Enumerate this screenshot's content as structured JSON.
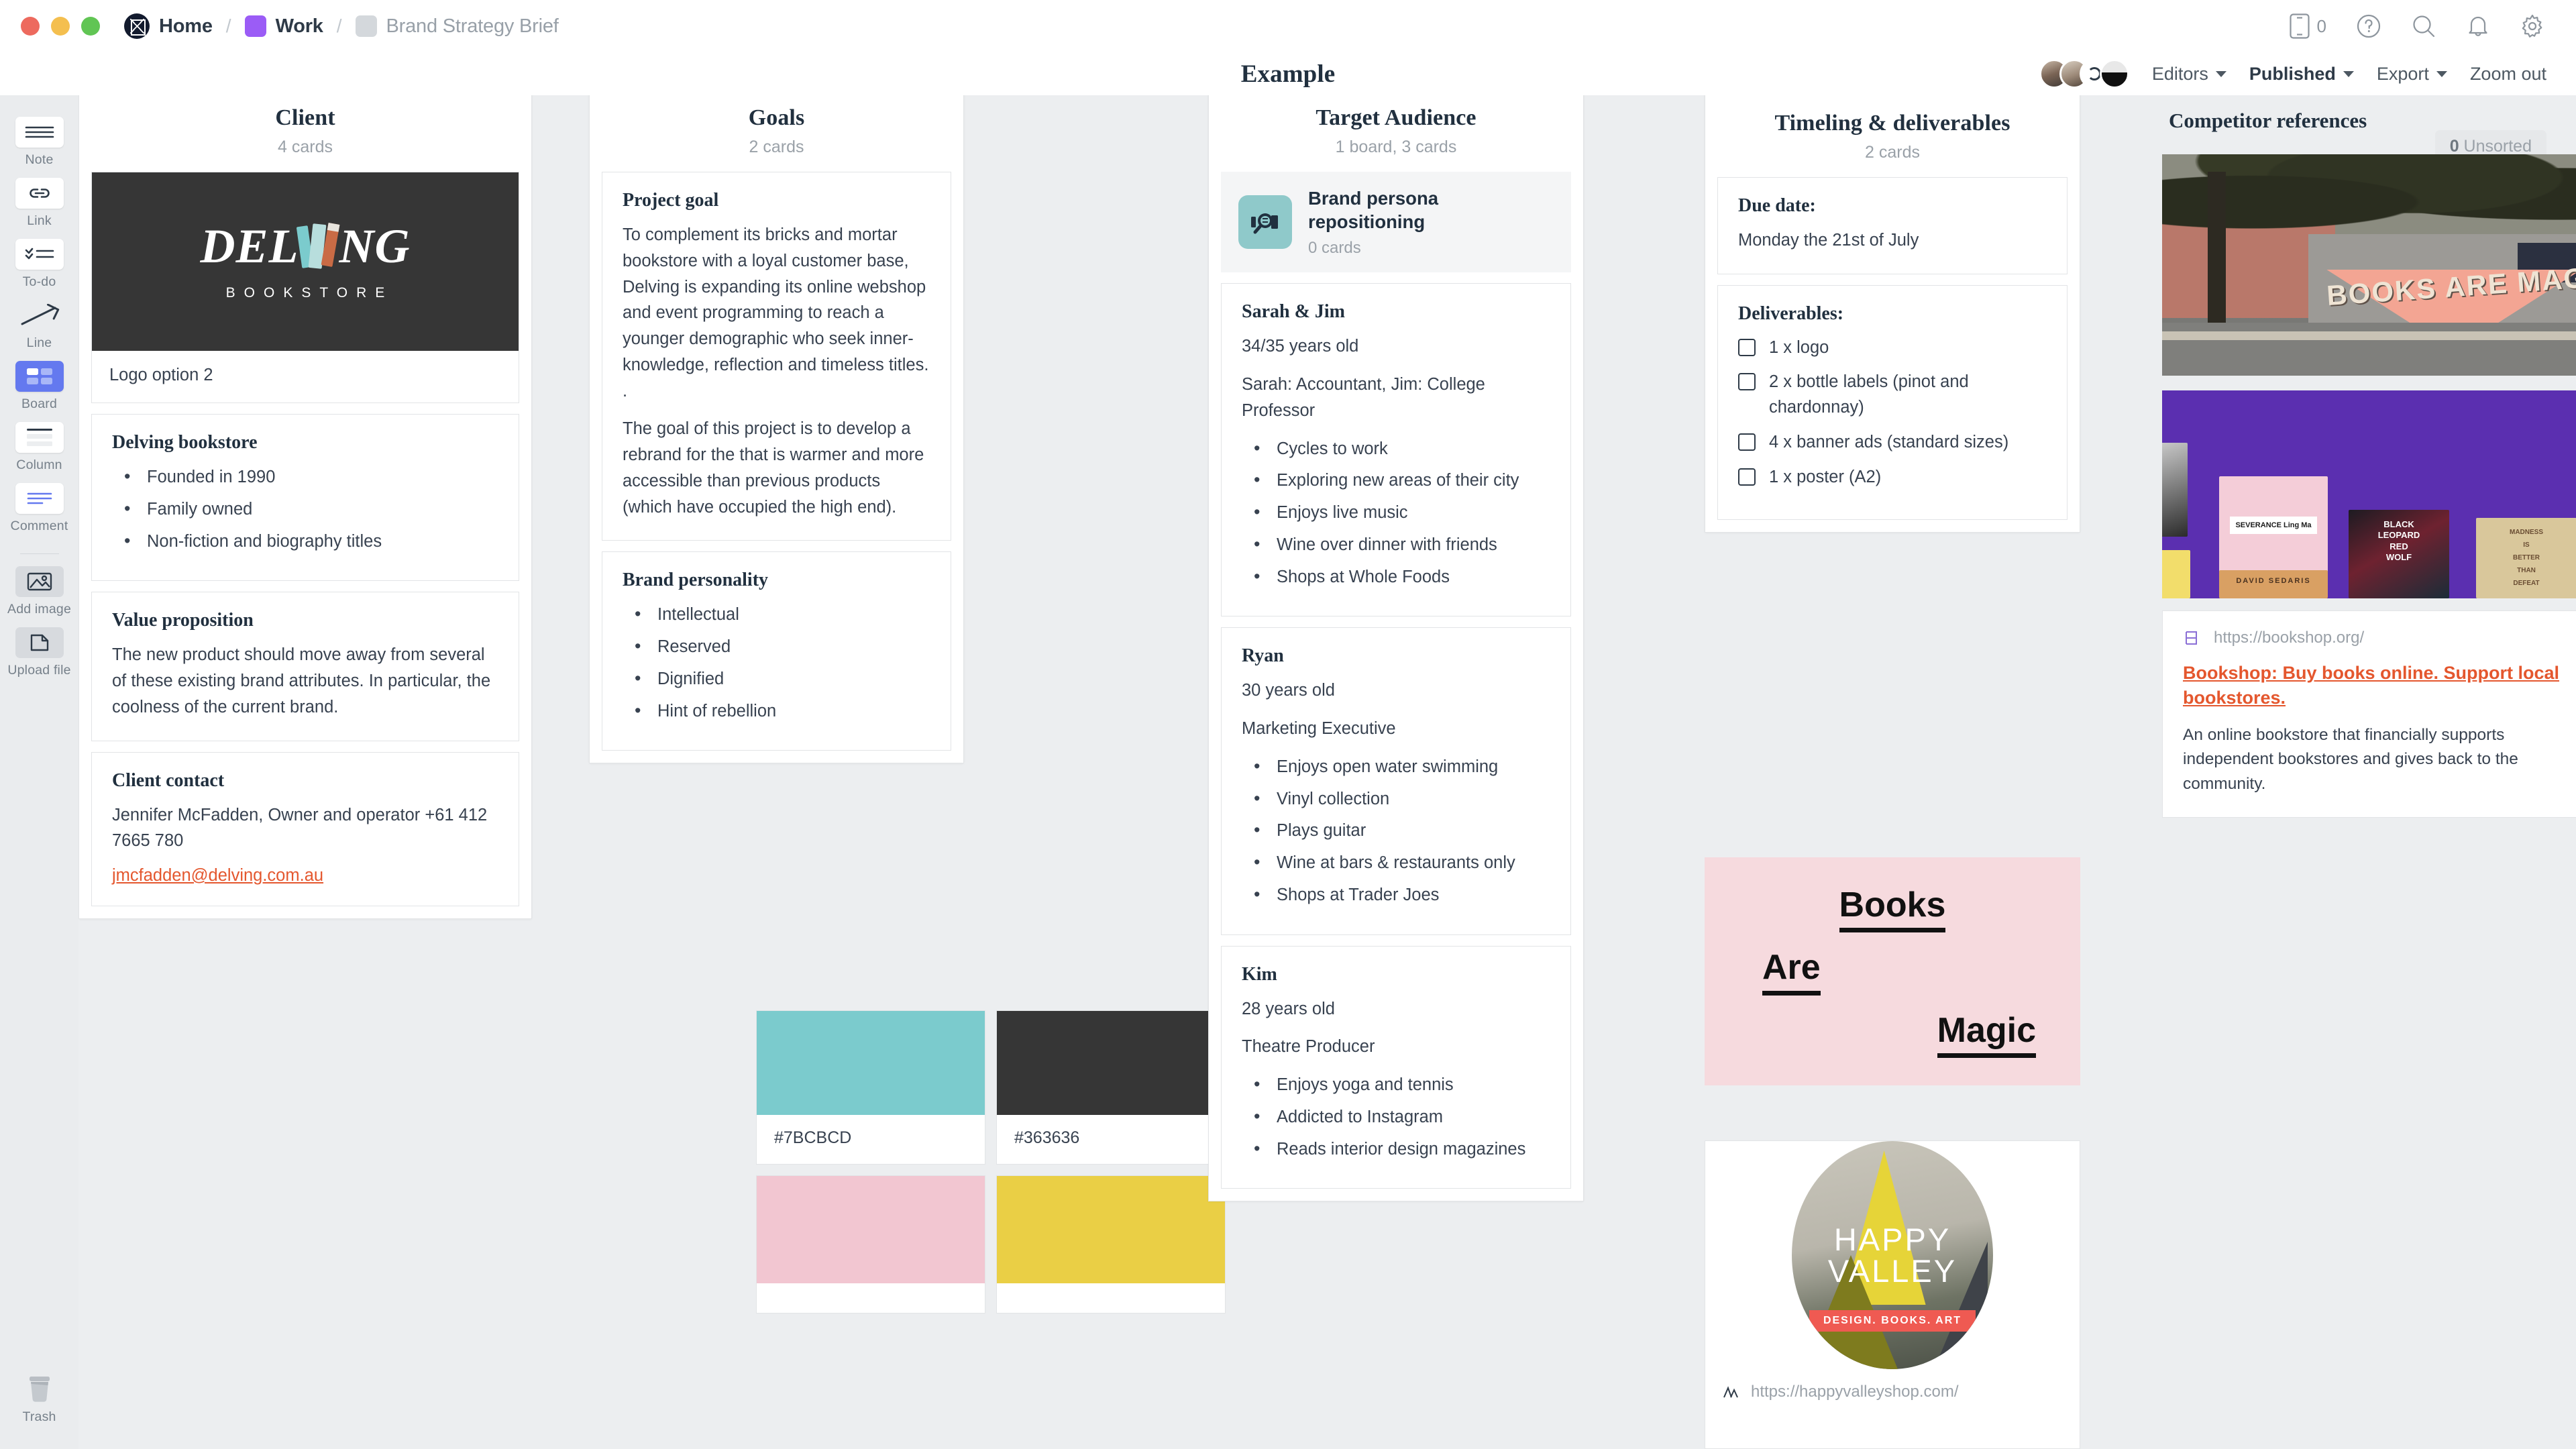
{
  "window": {
    "traffic_lights": [
      "close",
      "minimize",
      "zoom"
    ]
  },
  "breadcrumb": {
    "home": "Home",
    "workspace": "Work",
    "board": "Brand Strategy Brief",
    "separator": "/"
  },
  "topbar_right": {
    "device_count": "0",
    "icons": [
      "mobile-icon",
      "help-icon",
      "search-icon",
      "notifications-icon",
      "settings-icon"
    ]
  },
  "subbar": {
    "title": "Example",
    "editors_label": "Editors",
    "published_label": "Published",
    "export_label": "Export",
    "zoom_out_label": "Zoom out"
  },
  "sidebar": {
    "tools": [
      {
        "label": "Note",
        "icon": "note-icon"
      },
      {
        "label": "Link",
        "icon": "link-icon"
      },
      {
        "label": "To-do",
        "icon": "todo-icon"
      },
      {
        "label": "Line",
        "icon": "line-icon"
      },
      {
        "label": "Board",
        "icon": "board-icon"
      },
      {
        "label": "Column",
        "icon": "column-icon"
      },
      {
        "label": "Comment",
        "icon": "comment-icon"
      }
    ],
    "media": [
      {
        "label": "Add image",
        "icon": "image-icon"
      },
      {
        "label": "Upload file",
        "icon": "file-icon"
      }
    ],
    "trash": {
      "label": "Trash",
      "icon": "trash-icon"
    }
  },
  "canvas": {
    "unsorted_count": "0",
    "unsorted_label": "Unsorted"
  },
  "columns": [
    {
      "title": "Client",
      "subtitle": "4 cards",
      "image_card": {
        "logo_word": "DELVING",
        "logo_sub": "BOOKSTORE",
        "caption": "Logo option 2"
      },
      "cards": [
        {
          "title": "Delving bookstore",
          "bullets": [
            "Founded in 1990",
            "Family owned",
            "Non-fiction and biography titles"
          ]
        },
        {
          "title": "Value proposition",
          "paragraphs": [
            "The new product should move away from several of these existing brand attributes. In particular, the coolness of the current brand."
          ]
        },
        {
          "title": "Client contact",
          "paragraphs": [
            "Jennifer McFadden, Owner and operator +61 412 7665 780"
          ],
          "email": "jmcfadden@delving.com.au"
        }
      ]
    },
    {
      "title": "Goals",
      "subtitle": "2 cards",
      "cards": [
        {
          "title": "Project goal",
          "paragraphs": [
            "To complement its bricks and mortar bookstore with a loyal customer base, Delving is expanding its online webshop and event programming to reach a younger demographic who seek inner-knowledge, reflection and timeless titles. .",
            "The goal of this project is to develop a rebrand for the  that is warmer and more accessible than previous products (which have occupied the high end)."
          ]
        },
        {
          "title": "Brand personality",
          "bullets": [
            "Intellectual",
            "Reserved",
            "Dignified",
            "Hint of rebellion"
          ]
        }
      ]
    },
    {
      "title": "Target Audience",
      "subtitle": "1 board, 3 cards",
      "board_tile": {
        "name": "Brand persona repositioning",
        "subtitle": "0 cards",
        "icon": "board-search-icon"
      },
      "cards": [
        {
          "title": "Sarah & Jim",
          "paragraphs": [
            "34/35 years old",
            "Sarah: Accountant, Jim: College Professor"
          ],
          "bullets": [
            "Cycles to work",
            "Exploring new areas of their city",
            "Enjoys live music",
            "Wine over dinner with friends",
            "Shops at Whole Foods"
          ]
        },
        {
          "title": "Ryan",
          "paragraphs": [
            "30 years old",
            "Marketing Executive"
          ],
          "bullets": [
            "Enjoys open water swimming",
            "Vinyl collection",
            "Plays guitar",
            "Wine at bars & restaurants only",
            "Shops at Trader Joes"
          ]
        },
        {
          "title": "Kim",
          "paragraphs": [
            "28 years old",
            "Theatre Producer"
          ],
          "bullets": [
            "Enjoys yoga and tennis",
            "Addicted to Instagram",
            "Reads interior design magazines"
          ]
        }
      ]
    },
    {
      "title": "Timeling & deliverables",
      "subtitle": "2 cards",
      "accent_color": "#84c4c6",
      "cards": [
        {
          "title": "Due date:",
          "paragraphs": [
            "Monday the 21st of July"
          ]
        },
        {
          "title": "Deliverables:",
          "checklist": [
            {
              "label": "1 x logo",
              "checked": false
            },
            {
              "label": "2 x bottle labels (pinot and chardonnay)",
              "checked": false
            },
            {
              "label": "4 x banner ads (standard sizes)",
              "checked": false
            },
            {
              "label": "1 x poster (A2)",
              "checked": false
            }
          ]
        }
      ]
    }
  ],
  "swatches": [
    {
      "hex": "#7BCBCD",
      "label": "#7BCBCD"
    },
    {
      "hex": "#363636",
      "label": "#363636"
    },
    {
      "hex": "#F2C6D1",
      "label": ""
    },
    {
      "hex": "#EACF45",
      "label": ""
    }
  ],
  "pink_poster": {
    "line1": "Books",
    "line2": "Are",
    "line3": "Magic",
    "background": "#F6DADE"
  },
  "happy_valley": {
    "title_line1": "HAPPY",
    "title_line2": "VALLEY",
    "ribbon": "DESIGN. BOOKS. ART",
    "url": "https://happyvalleyshop.com/"
  },
  "competitor": {
    "title": "Competitor references",
    "photo_caption": "BOOKS ARE MAGIC",
    "covers": [
      "SEVERANCE Ling Ma",
      "BLACK LEOPARD RED WOLF MARLON JAMES",
      "MADNESS IS BETTER THAN DEFEAT",
      "DAVID SEDARIS"
    ],
    "link_card": {
      "url": "https://bookshop.org/",
      "title": "Bookshop: Buy books online. Support local bookstores.",
      "description": "An online bookstore that financially supports independent bookstores and gives back to the community.",
      "favicon": "bookshop-icon"
    }
  }
}
